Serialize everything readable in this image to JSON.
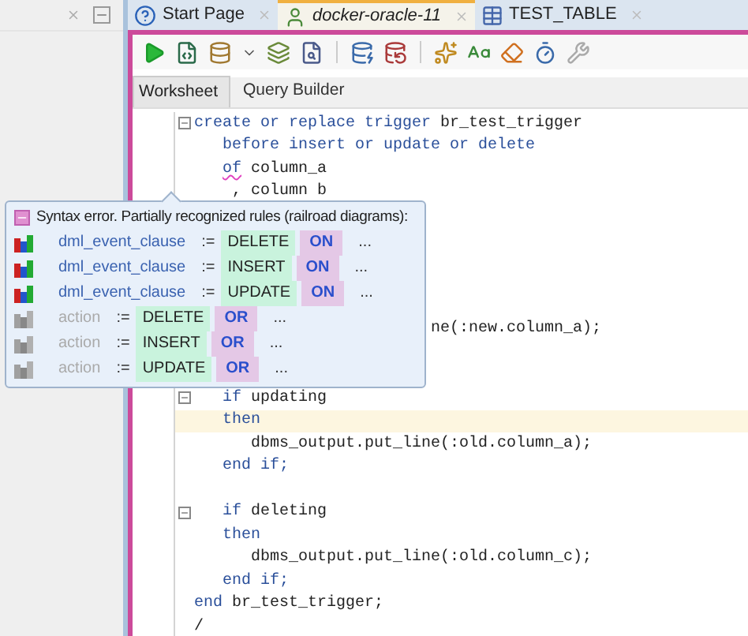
{
  "tabs": [
    {
      "label": "Start Page",
      "selected": false
    },
    {
      "label": "docker-oracle-11",
      "selected": true
    },
    {
      "label": "TEST_TABLE",
      "selected": false
    }
  ],
  "sheet_tabs": [
    {
      "label": "Worksheet",
      "selected": true
    },
    {
      "label": "Query Builder",
      "selected": false
    }
  ],
  "code": {
    "segments": [
      {
        "lines": [
          {
            "fold": true,
            "highlighted": false,
            "tokens": [
              {
                "text": "create or replace trigger",
                "kind": "keyword"
              },
              {
                "text": " br_test_trigger",
                "kind": "plain"
              }
            ]
          },
          {
            "fold": false,
            "highlighted": false,
            "tokens": [
              {
                "text": "   before insert or update or delete",
                "kind": "keyword"
              }
            ]
          },
          {
            "fold": false,
            "highlighted": false,
            "tokens": [
              {
                "text": "   of",
                "kind": "error"
              },
              {
                "text": " column_a",
                "kind": "plain"
              }
            ]
          },
          {
            "fold": false,
            "highlighted": false,
            "tokens": [
              {
                "text": "    , column b",
                "kind": "plain"
              }
            ]
          }
        ]
      },
      {
        "lines": [
          {
            "highlighted": false,
            "tokens": [
              {
                "text": "ne(:new.column_a);",
                "kind": "plain"
              }
            ]
          }
        ]
      },
      {
        "lines": [
          {
            "fold": true,
            "highlighted": false,
            "tokens": [
              {
                "text": "   if",
                "kind": "keyword"
              },
              {
                "text": " updating",
                "kind": "plain"
              }
            ]
          },
          {
            "fold": false,
            "highlighted": true,
            "tokens": [
              {
                "text": "   then",
                "kind": "keyword"
              }
            ]
          },
          {
            "fold": false,
            "highlighted": false,
            "tokens": [
              {
                "text": "      dbms_output.put_line(:old.column_a);",
                "kind": "plain"
              }
            ]
          },
          {
            "fold": false,
            "highlighted": false,
            "tokens": [
              {
                "text": "   end if;",
                "kind": "keyword"
              }
            ]
          }
        ]
      },
      {
        "lines": [
          {
            "fold": true,
            "highlighted": false,
            "tokens": [
              {
                "text": "   if",
                "kind": "keyword"
              },
              {
                "text": " deleting",
                "kind": "plain"
              }
            ]
          },
          {
            "fold": false,
            "highlighted": false,
            "tokens": [
              {
                "text": "   then",
                "kind": "keyword"
              }
            ]
          },
          {
            "fold": false,
            "highlighted": false,
            "tokens": [
              {
                "text": "      dbms_output.put_line(:old.column_c);",
                "kind": "plain"
              }
            ]
          },
          {
            "fold": false,
            "highlighted": false,
            "tokens": [
              {
                "text": "   end if;",
                "kind": "keyword"
              }
            ]
          },
          {
            "fold": false,
            "highlighted": false,
            "tokens": [
              {
                "text": "end",
                "kind": "keyword"
              },
              {
                "text": " br_test_trigger;",
                "kind": "plain"
              }
            ]
          },
          {
            "fold": false,
            "highlighted": false,
            "tokens": [
              {
                "text": "/",
                "kind": "plain"
              }
            ]
          }
        ]
      }
    ]
  },
  "popup": {
    "title": "Syntax error. Partially recognized rules (railroad diagrams):",
    "rules": [
      {
        "name": "dml_event_clause",
        "assign": ":=",
        "first": "DELETE",
        "second": "ON",
        "more": "...",
        "disabled": false
      },
      {
        "name": "dml_event_clause",
        "assign": ":=",
        "first": "INSERT",
        "second": "ON",
        "more": "...",
        "disabled": false
      },
      {
        "name": "dml_event_clause",
        "assign": ":=",
        "first": "UPDATE",
        "second": "ON",
        "more": "...",
        "disabled": false
      },
      {
        "name": "action",
        "assign": ":=",
        "first": "DELETE",
        "second": "OR",
        "more": "...",
        "disabled": true
      },
      {
        "name": "action",
        "assign": ":=",
        "first": "INSERT",
        "second": "OR",
        "more": "...",
        "disabled": true
      },
      {
        "name": "action",
        "assign": ":=",
        "first": "UPDATE",
        "second": "OR",
        "more": "...",
        "disabled": true
      }
    ]
  }
}
